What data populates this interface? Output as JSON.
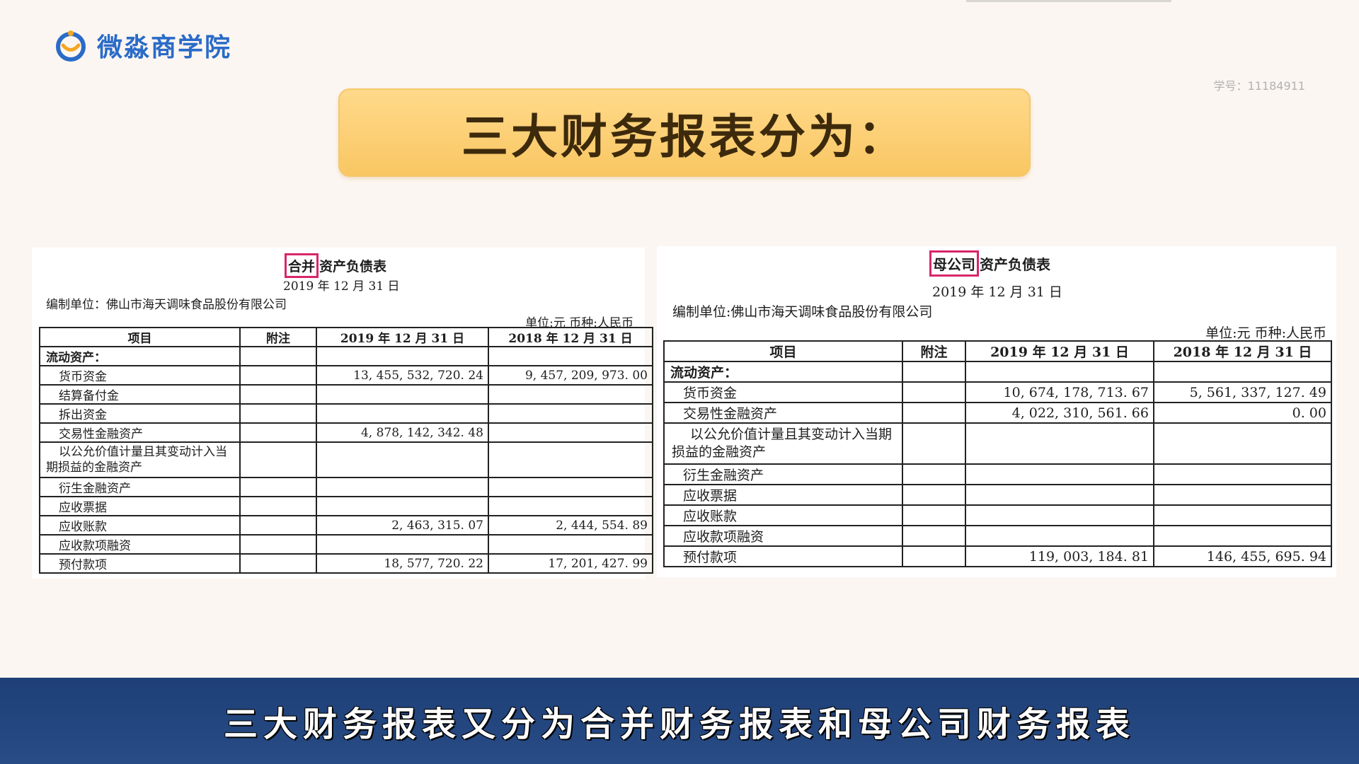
{
  "brand": {
    "name": "微淼商学院"
  },
  "student_id": "学号：11184911",
  "title": "三大财务报表分为：",
  "subtitle": "三大财务报表又分为合并财务报表和母公司财务报表",
  "colors": {
    "highlight_box": "#d8266a",
    "subtitle_bar": "#1e3f77",
    "title_box": "#f9c763",
    "logo_blue": "#2a6bc8",
    "logo_orange": "#f5a623"
  },
  "left_sheet": {
    "title_highlight": "合并",
    "title_rest": "资产负债表",
    "date": "2019 年 12 月 31 日",
    "company": "编制单位：佛山市海天调味食品股份有限公司",
    "unit": "单位:元    币种:人民币",
    "headers": [
      "项目",
      "附注",
      "2019 年 12 月 31 日",
      "2018 年 12 月 31 日"
    ],
    "rows": [
      {
        "item": "流动资产：",
        "note": "",
        "y2019": "",
        "y2018": ""
      },
      {
        "item": "货币资金",
        "note": "",
        "y2019": "13, 455, 532, 720. 24",
        "y2018": "9, 457, 209, 973. 00"
      },
      {
        "item": "结算备付金",
        "note": "",
        "y2019": "",
        "y2018": ""
      },
      {
        "item": "拆出资金",
        "note": "",
        "y2019": "",
        "y2018": ""
      },
      {
        "item": "交易性金融资产",
        "note": "",
        "y2019": "4, 878, 142, 342. 48",
        "y2018": ""
      },
      {
        "item": "以公允价值计量且其变动计入当期损益的金融资产",
        "note": "",
        "y2019": "",
        "y2018": ""
      },
      {
        "item": "衍生金融资产",
        "note": "",
        "y2019": "",
        "y2018": ""
      },
      {
        "item": "应收票据",
        "note": "",
        "y2019": "",
        "y2018": ""
      },
      {
        "item": "应收账款",
        "note": "",
        "y2019": "2, 463, 315. 07",
        "y2018": "2, 444, 554. 89"
      },
      {
        "item": "应收款项融资",
        "note": "",
        "y2019": "",
        "y2018": ""
      },
      {
        "item": "预付款项",
        "note": "",
        "y2019": "18, 577, 720. 22",
        "y2018": "17, 201, 427. 99"
      }
    ]
  },
  "right_sheet": {
    "title_highlight": "母公司",
    "title_rest": "资产负债表",
    "date": "2019 年 12 月 31 日",
    "company": "编制单位:佛山市海天调味食品股份有限公司",
    "unit": "单位:元    币种:人民币",
    "headers": [
      "项目",
      "附注",
      "2019 年 12 月 31 日",
      "2018 年 12 月 31 日"
    ],
    "rows": [
      {
        "item": "流动资产：",
        "note": "",
        "y2019": "",
        "y2018": ""
      },
      {
        "item": "货币资金",
        "note": "",
        "y2019": "10, 674, 178, 713. 67",
        "y2018": "5, 561, 337, 127. 49"
      },
      {
        "item": "交易性金融资产",
        "note": "",
        "y2019": "4, 022, 310, 561. 66",
        "y2018": "0. 00"
      },
      {
        "item": "以公允价值计量且其变动计入当期损益的金融资产",
        "note": "",
        "y2019": "",
        "y2018": ""
      },
      {
        "item": "衍生金融资产",
        "note": "",
        "y2019": "",
        "y2018": ""
      },
      {
        "item": "应收票据",
        "note": "",
        "y2019": "",
        "y2018": ""
      },
      {
        "item": "应收账款",
        "note": "",
        "y2019": "",
        "y2018": ""
      },
      {
        "item": "应收款项融资",
        "note": "",
        "y2019": "",
        "y2018": ""
      },
      {
        "item": "预付款项",
        "note": "",
        "y2019": "119, 003, 184. 81",
        "y2018": "146, 455, 695. 94"
      }
    ]
  }
}
